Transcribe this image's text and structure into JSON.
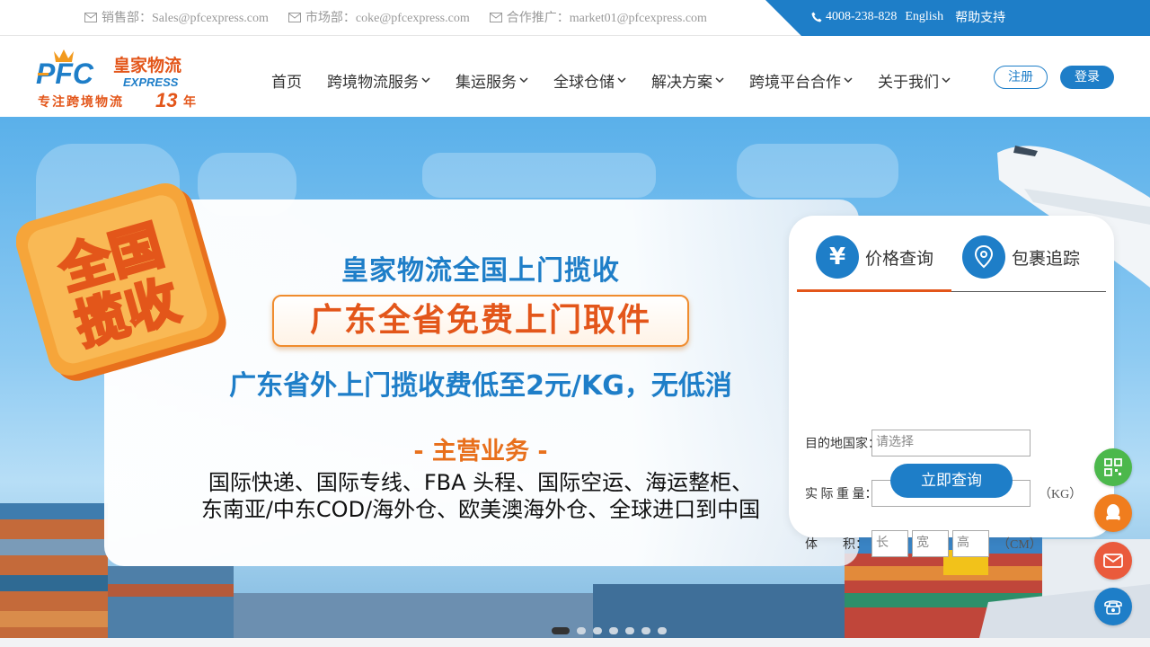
{
  "topbar": {
    "contacts": [
      {
        "label": "销售部：Sales@pfcexpress.com",
        "icon": "mail-icon"
      },
      {
        "label": "市场部：coke@pfcexpress.com",
        "icon": "mail-icon"
      },
      {
        "label": "合作推广：market01@pfcexpress.com",
        "icon": "mail-icon"
      }
    ],
    "phone": "4008-238-828",
    "english": "English",
    "help": "帮助支持",
    "accent_color": "#1e7ec8"
  },
  "logo": {
    "brand": "PFC",
    "express": "EXPRESS",
    "cn_name": "皇家物流",
    "slogan": "专注跨境物流",
    "years": "13",
    "years_suffix": "年"
  },
  "nav": {
    "items": [
      {
        "label": "首页",
        "dropdown": false
      },
      {
        "label": "跨境物流服务",
        "dropdown": true
      },
      {
        "label": "集运服务",
        "dropdown": true
      },
      {
        "label": "全球仓储",
        "dropdown": true
      },
      {
        "label": "解决方案",
        "dropdown": true
      },
      {
        "label": "跨境平台合作",
        "dropdown": true
      },
      {
        "label": "关于我们",
        "dropdown": true
      }
    ],
    "register": "注册",
    "login": "登录"
  },
  "banner": {
    "badge_line1": "全国",
    "badge_line2": "揽收",
    "title": "皇家物流全国上门揽收",
    "highlight": "广东全省免费上门取件",
    "subtitle": "广东省外上门揽收费低至2元/KG，无低消",
    "main_business": "- 主营业务 -",
    "business_line1": "国际快递、国际专线、FBA 头程、国际空运、海运整柜、",
    "business_line2": "东南亚/中东COD/海外仓、欧美澳海外仓、全球进口到中国",
    "slides": 8,
    "active_slide": 1
  },
  "query": {
    "tabs": [
      {
        "label": "价格查询",
        "icon": "yen-icon",
        "symbol": "¥"
      },
      {
        "label": "包裹追踪",
        "icon": "location-pin-icon"
      }
    ],
    "destination_label": "目的地国家：",
    "destination_placeholder": "请选择",
    "weight_label": "实 际 重 量：",
    "weight_unit": "（KG）",
    "volume_label": "体　　积：",
    "length_placeholder": "长",
    "width_placeholder": "宽",
    "height_placeholder": "高",
    "volume_unit": "（CM）",
    "submit": "立即查询"
  },
  "side_buttons": [
    {
      "icon": "qrcode-icon",
      "color": "#4cb84c"
    },
    {
      "icon": "qq-icon",
      "color": "#f07d1e"
    },
    {
      "icon": "email-icon",
      "color": "#ea5a3c"
    },
    {
      "icon": "phone-icon",
      "color": "#1e7ec8"
    }
  ]
}
